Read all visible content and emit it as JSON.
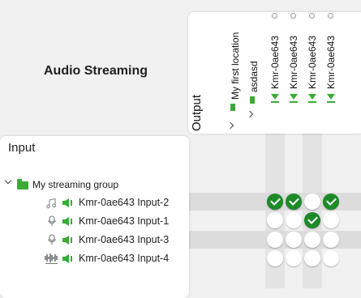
{
  "app": {
    "title": "Audio Streaming"
  },
  "colors": {
    "accent_green": "#3aaa35",
    "check_green": "#1d8a28"
  },
  "output": {
    "label": "Output",
    "tree": [
      {
        "label": "My first location",
        "icon": "folder-icon"
      },
      {
        "label": "asdasd",
        "icon": "folder-icon"
      }
    ],
    "columns": [
      {
        "label": "Kmr-0ae643",
        "icon": "output-device-icon"
      },
      {
        "label": "Kmr-0ae643",
        "icon": "output-device-icon"
      },
      {
        "label": "Kmr-0ae643",
        "icon": "output-device-icon"
      },
      {
        "label": "Kmr-0ae643",
        "icon": "output-device-icon"
      }
    ]
  },
  "input": {
    "label": "Input",
    "group": {
      "label": "My streaming group",
      "icon": "folder-icon"
    },
    "rows": [
      {
        "label": "Kmr-0ae643 Input-2",
        "device_icon": "music-note-icon",
        "routing": [
          true,
          true,
          false,
          true
        ]
      },
      {
        "label": "Kmr-0ae643 Input-1",
        "device_icon": "microphone-icon",
        "routing": [
          false,
          false,
          true,
          false
        ]
      },
      {
        "label": "Kmr-0ae643 Input-3",
        "device_icon": "microphone-icon",
        "routing": [
          false,
          false,
          false,
          false
        ]
      },
      {
        "label": "Kmr-0ae643 Input-4",
        "device_icon": "audio-wave-icon",
        "routing": [
          false,
          false,
          false,
          false
        ]
      }
    ]
  }
}
